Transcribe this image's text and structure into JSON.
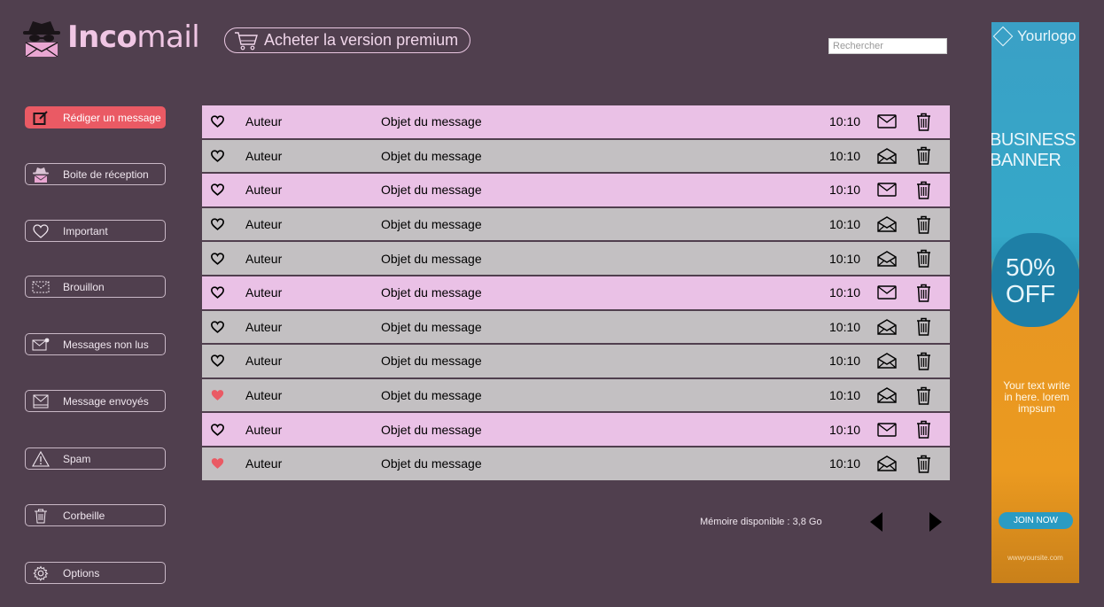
{
  "header": {
    "logo_part1": "Inco",
    "logo_part2": "mail",
    "premium_label": "Acheter la version premium",
    "search_placeholder": "Rechercher"
  },
  "sidebar": {
    "items": [
      {
        "label": "Rédiger un message",
        "icon": "compose-icon"
      },
      {
        "label": "Boite de réception",
        "icon": "spy-inbox-icon"
      },
      {
        "label": "Important",
        "icon": "heart-icon"
      },
      {
        "label": "Brouillon",
        "icon": "draft-icon"
      },
      {
        "label": "Messages non lus",
        "icon": "unread-mail-icon"
      },
      {
        "label": "Message envoyés",
        "icon": "sent-mail-icon"
      },
      {
        "label": "Spam",
        "icon": "warning-icon"
      },
      {
        "label": "Corbeille",
        "icon": "trash-icon"
      },
      {
        "label": "Options",
        "icon": "gear-icon"
      }
    ]
  },
  "colors": {
    "background": "#503f4e",
    "unread_row": "#eac1e6",
    "read_row": "#c3c0c2",
    "accent": "#ea5a64"
  },
  "mails": [
    {
      "author": "Auteur",
      "subject": "Objet du message",
      "time": "10:10",
      "favorite": false,
      "unread": true
    },
    {
      "author": "Auteur",
      "subject": "Objet du message",
      "time": "10:10",
      "favorite": false,
      "unread": false
    },
    {
      "author": "Auteur",
      "subject": "Objet du message",
      "time": "10:10",
      "favorite": false,
      "unread": true
    },
    {
      "author": "Auteur",
      "subject": "Objet du message",
      "time": "10:10",
      "favorite": false,
      "unread": false
    },
    {
      "author": "Auteur",
      "subject": "Objet du message",
      "time": "10:10",
      "favorite": false,
      "unread": false
    },
    {
      "author": "Auteur",
      "subject": "Objet du message",
      "time": "10:10",
      "favorite": false,
      "unread": true
    },
    {
      "author": "Auteur",
      "subject": "Objet du message",
      "time": "10:10",
      "favorite": false,
      "unread": false
    },
    {
      "author": "Auteur",
      "subject": "Objet du message",
      "time": "10:10",
      "favorite": false,
      "unread": false
    },
    {
      "author": "Auteur",
      "subject": "Objet du message",
      "time": "10:10",
      "favorite": true,
      "unread": false
    },
    {
      "author": "Auteur",
      "subject": "Objet du message",
      "time": "10:10",
      "favorite": false,
      "unread": true
    },
    {
      "author": "Auteur",
      "subject": "Objet du message",
      "time": "10:10",
      "favorite": true,
      "unread": false
    }
  ],
  "footer": {
    "memory_text": "Mémoire disponible :  3,8 Go"
  },
  "ad": {
    "logo": "Yourlogo",
    "headline_line1": "BUSINESS",
    "headline_line2": "BANNER",
    "offer_line1": "50%",
    "offer_line2": "OFF",
    "body_text": "Your text write in here. lorem impsum",
    "cta": "JOIN NOW",
    "site": "wwwyoursite.com"
  }
}
